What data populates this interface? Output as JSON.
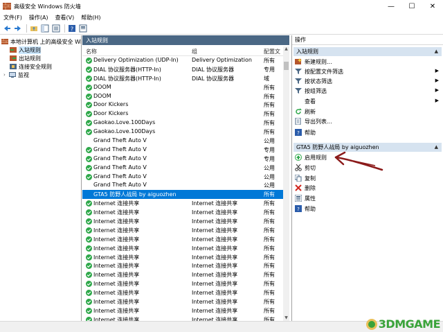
{
  "window": {
    "title": "高级安全 Windows 防火墙",
    "min": "—",
    "max": "☐",
    "close": "✕"
  },
  "menu": [
    "文件(F)",
    "操作(A)",
    "查看(V)",
    "帮助(H)"
  ],
  "tree": {
    "root": "本地计算机 上的高级安全 Wind",
    "items": [
      "入站规则",
      "出站规则",
      "连接安全规则",
      "监视"
    ]
  },
  "center": {
    "header": "入站规则",
    "columns": [
      "名称",
      "组",
      "配置文"
    ],
    "rows": [
      {
        "name": "Delivery Optimization (UDP-In)",
        "group": "Delivery Optimization",
        "profile": "所有",
        "enabled": true
      },
      {
        "name": "DIAL 协议服务器(HTTP-In)",
        "group": "DIAL 协议服务器",
        "profile": "专用",
        "enabled": true
      },
      {
        "name": "DIAL 协议服务器(HTTP-In)",
        "group": "DIAL 协议服务器",
        "profile": "域",
        "enabled": true
      },
      {
        "name": "DOOM",
        "group": "",
        "profile": "所有",
        "enabled": true
      },
      {
        "name": "DOOM",
        "group": "",
        "profile": "所有",
        "enabled": true
      },
      {
        "name": "Door Kickers",
        "group": "",
        "profile": "所有",
        "enabled": true
      },
      {
        "name": "Door Kickers",
        "group": "",
        "profile": "所有",
        "enabled": true
      },
      {
        "name": "Gaokao.Love.100Days",
        "group": "",
        "profile": "所有",
        "enabled": true
      },
      {
        "name": "Gaokao.Love.100Days",
        "group": "",
        "profile": "所有",
        "enabled": true
      },
      {
        "name": "Grand Theft Auto V",
        "group": "",
        "profile": "公用",
        "enabled": false
      },
      {
        "name": "Grand Theft Auto V",
        "group": "",
        "profile": "专用",
        "enabled": true
      },
      {
        "name": "Grand Theft Auto V",
        "group": "",
        "profile": "专用",
        "enabled": true
      },
      {
        "name": "Grand Theft Auto V",
        "group": "",
        "profile": "公用",
        "enabled": true
      },
      {
        "name": "Grand Theft Auto V",
        "group": "",
        "profile": "公用",
        "enabled": true
      },
      {
        "name": "Grand Theft Auto V",
        "group": "",
        "profile": "公用",
        "enabled": false
      },
      {
        "name": "GTA5 防野人战局 by aiguozhen",
        "group": "",
        "profile": "所有",
        "enabled": false,
        "selected": true
      },
      {
        "name": "Internet 连接共享",
        "group": "Internet 连接共享",
        "profile": "所有",
        "enabled": true
      },
      {
        "name": "Internet 连接共享",
        "group": "Internet 连接共享",
        "profile": "所有",
        "enabled": true
      },
      {
        "name": "Internet 连接共享",
        "group": "Internet 连接共享",
        "profile": "所有",
        "enabled": true
      },
      {
        "name": "Internet 连接共享",
        "group": "Internet 连接共享",
        "profile": "所有",
        "enabled": true
      },
      {
        "name": "Internet 连接共享",
        "group": "Internet 连接共享",
        "profile": "所有",
        "enabled": true
      },
      {
        "name": "Internet 连接共享",
        "group": "Internet 连接共享",
        "profile": "所有",
        "enabled": true
      },
      {
        "name": "Internet 连接共享",
        "group": "Internet 连接共享",
        "profile": "所有",
        "enabled": true
      },
      {
        "name": "Internet 连接共享",
        "group": "Internet 连接共享",
        "profile": "所有",
        "enabled": true
      },
      {
        "name": "Internet 连接共享",
        "group": "Internet 连接共享",
        "profile": "所有",
        "enabled": true
      },
      {
        "name": "Internet 连接共享",
        "group": "Internet 连接共享",
        "profile": "所有",
        "enabled": true
      },
      {
        "name": "Internet 连接共享",
        "group": "Internet 连接共享",
        "profile": "所有",
        "enabled": true
      },
      {
        "name": "Internet 连接共享",
        "group": "Internet 连接共享",
        "profile": "所有",
        "enabled": true
      },
      {
        "name": "Internet 连接共享",
        "group": "Internet 连接共享",
        "profile": "所有",
        "enabled": true
      },
      {
        "name": "Internet 连接共享",
        "group": "Internet 连接共享",
        "profile": "所有",
        "enabled": true
      }
    ]
  },
  "actions": {
    "title": "操作",
    "section1": {
      "header": "入站规则",
      "items": [
        "新建规则...",
        "按配置文件筛选",
        "按状态筛选",
        "按组筛选",
        "查看",
        "刷新",
        "导出列表...",
        "帮助"
      ]
    },
    "section2": {
      "header": "GTA5 防野人战局 by aiguozhen",
      "items": [
        "启用规则",
        "剪切",
        "复制",
        "删除",
        "属性",
        "帮助"
      ]
    }
  },
  "watermark": "3DMGAME",
  "colors": {
    "accent": "#0078d7",
    "header": "#4a6784",
    "section": "#d6e3f0",
    "enabled": "#2ea84a",
    "annotation": "#8b1a1a"
  }
}
